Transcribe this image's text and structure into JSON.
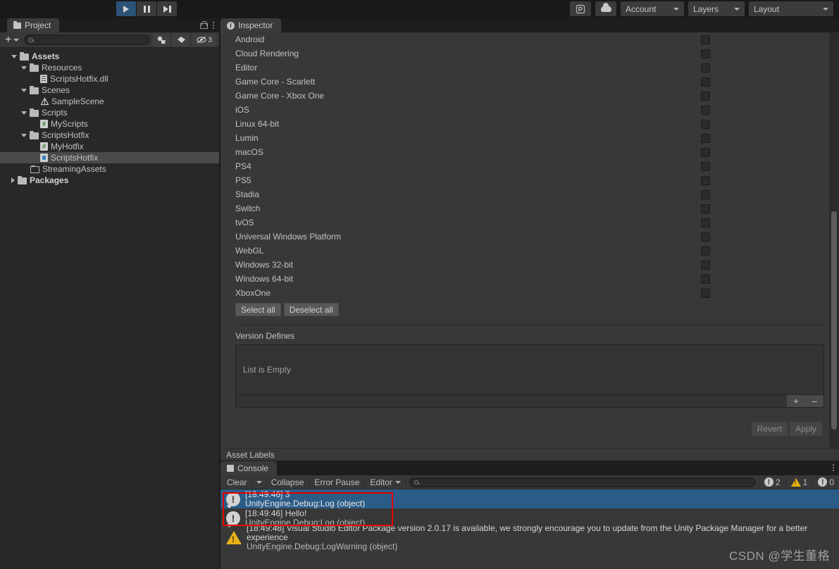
{
  "toolbar": {
    "play_icon": "play-icon",
    "pause_icon": "pause-icon",
    "step_icon": "step-icon",
    "collab_icon": "collab-icon",
    "cloud_icon": "cloud-icon",
    "account_label": "Account",
    "layers_label": "Layers",
    "layout_label": "Layout"
  },
  "project": {
    "tab_label": "Project",
    "search_placeholder": "",
    "search_value": "",
    "hidden_count": "3",
    "tree": [
      {
        "label": "Assets",
        "depth": 0,
        "arrow": "down",
        "icon": "folder-icon",
        "bold": true,
        "selected": false
      },
      {
        "label": "Resources",
        "depth": 1,
        "arrow": "down",
        "icon": "folder-icon",
        "bold": false,
        "selected": false
      },
      {
        "label": "ScriptsHotfix.dll",
        "depth": 2,
        "arrow": "none",
        "icon": "dll-icon",
        "bold": false,
        "selected": false
      },
      {
        "label": "Scenes",
        "depth": 1,
        "arrow": "down",
        "icon": "folder-icon",
        "bold": false,
        "selected": false
      },
      {
        "label": "SampleScene",
        "depth": 2,
        "arrow": "none",
        "icon": "unity-scene-icon",
        "bold": false,
        "selected": false
      },
      {
        "label": "Scripts",
        "depth": 1,
        "arrow": "down",
        "icon": "folder-icon",
        "bold": false,
        "selected": false
      },
      {
        "label": "MyScripts",
        "depth": 2,
        "arrow": "none",
        "icon": "csharp-icon",
        "bold": false,
        "selected": false
      },
      {
        "label": "ScriptsHotfix",
        "depth": 1,
        "arrow": "down",
        "icon": "folder-icon",
        "bold": false,
        "selected": false
      },
      {
        "label": "MyHotfix",
        "depth": 2,
        "arrow": "none",
        "icon": "csharp-icon",
        "bold": false,
        "selected": false
      },
      {
        "label": "ScriptsHotfix",
        "depth": 2,
        "arrow": "none",
        "icon": "assembly-definition-icon",
        "bold": false,
        "selected": true
      },
      {
        "label": "StreamingAssets",
        "depth": 1,
        "arrow": "none",
        "icon": "folder-empty-icon",
        "bold": false,
        "selected": false
      },
      {
        "label": "Packages",
        "depth": 0,
        "arrow": "right",
        "icon": "folder-icon",
        "bold": true,
        "selected": false
      }
    ]
  },
  "inspector": {
    "tab_label": "Inspector",
    "platforms": [
      {
        "name": "Android",
        "checked": false
      },
      {
        "name": "Cloud Rendering",
        "checked": false
      },
      {
        "name": "Editor",
        "checked": false
      },
      {
        "name": "Game Core - Scarlett",
        "checked": false
      },
      {
        "name": "Game Core - Xbox One",
        "checked": false
      },
      {
        "name": "iOS",
        "checked": false
      },
      {
        "name": "Linux 64-bit",
        "checked": false
      },
      {
        "name": "Lumin",
        "checked": false
      },
      {
        "name": "macOS",
        "checked": false
      },
      {
        "name": "PS4",
        "checked": false
      },
      {
        "name": "PS5",
        "checked": false
      },
      {
        "name": "Stadia",
        "checked": false
      },
      {
        "name": "Switch",
        "checked": false
      },
      {
        "name": "tvOS",
        "checked": false
      },
      {
        "name": "Universal Windows Platform",
        "checked": false
      },
      {
        "name": "WebGL",
        "checked": false
      },
      {
        "name": "Windows 32-bit",
        "checked": false
      },
      {
        "name": "Windows 64-bit",
        "checked": false
      },
      {
        "name": "XboxOne",
        "checked": false
      }
    ],
    "select_all_label": "Select all",
    "deselect_all_label": "Deselect all",
    "version_defines_title": "Version Defines",
    "version_defines_empty": "List is Empty",
    "add_label": "+",
    "remove_label": "–",
    "revert_label": "Revert",
    "apply_label": "Apply",
    "asset_labels_title": "Asset Labels"
  },
  "console": {
    "tab_label": "Console",
    "clear_label": "Clear",
    "collapse_label": "Collapse",
    "error_pause_label": "Error Pause",
    "editor_label": "Editor",
    "search_placeholder": "",
    "search_value": "",
    "counts": {
      "error": "2",
      "warning": "1",
      "info": "0"
    },
    "entries": [
      {
        "type": "log",
        "message": "[18:49:46] 3",
        "stack": "UnityEngine.Debug:Log (object)",
        "selected": true
      },
      {
        "type": "log",
        "message": "[18:49:46] Hello!",
        "stack": "UnityEngine.Debug:Log (object)",
        "selected": false
      },
      {
        "type": "warning",
        "message": "[18:49:48] Visual Studio Editor Package version 2.0.17 is available, we strongly encourage you to update from the Unity Package Manager for a better experience",
        "stack": "UnityEngine.Debug:LogWarning (object)",
        "selected": false
      }
    ]
  },
  "watermark": {
    "text": "CSDN @学生董格"
  },
  "colors": {
    "play_active": "#2b5277",
    "panel_bg": "#383838",
    "project_bg": "#282828",
    "selection_blue": "#2b5c87",
    "highlight_box": "#e60000",
    "warning_yellow": "#e8b21a"
  }
}
